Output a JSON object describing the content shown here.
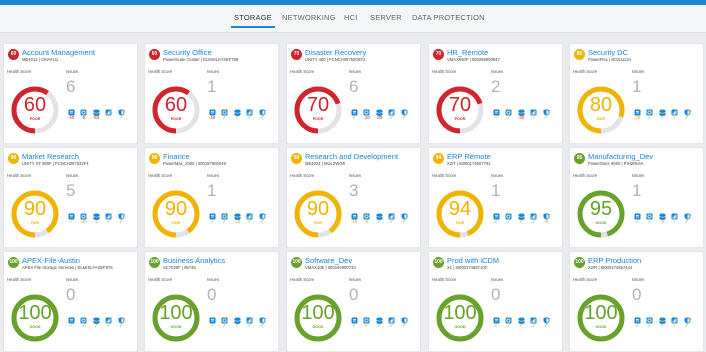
{
  "colors": {
    "accent": "#1a86d0",
    "poor": "#d0242e",
    "fair": "#f0b400",
    "good": "#67a22a"
  },
  "tabs": [
    "STORAGE",
    "NETWORKING",
    "HCI",
    "SERVER",
    "DATA PROTECTION"
  ],
  "labels": {
    "health": "Health Score",
    "issues": "Issues"
  },
  "category_icons": [
    "capacity-icon",
    "performance-icon",
    "system-health-icon",
    "configuration-icon",
    "data-protection-icon"
  ],
  "cards": [
    {
      "score": "60",
      "title": "Account Management",
      "sub": "ME4012 | CI0AFU1",
      "health": 60,
      "status": "POOR",
      "issues": "6",
      "stats": [
        "-40",
        "-5",
        "-53",
        "–",
        "–"
      ]
    },
    {
      "score": "60",
      "title": "Security Office",
      "sub": "PowerScale Cluster | ELMISLFASEF789",
      "health": 60,
      "status": "POOR",
      "issues": "1",
      "stats": [
        "-40",
        "✓",
        "✓",
        "✓",
        "✓"
      ]
    },
    {
      "score": "70",
      "title": "Disaster Recovery",
      "sub": "UNITY 400 | FCNCH097520SF2",
      "health": 70,
      "status": "POOR",
      "issues": "6",
      "stats": [
        "✓",
        "-10",
        "-30",
        "✓",
        "✓"
      ]
    },
    {
      "score": "70",
      "title": "HR_Remote",
      "sub": "VMAX950F | 000296800847",
      "health": 70,
      "status": "POOR",
      "issues": "2",
      "stats": [
        "–",
        "✓",
        "-30",
        "–",
        "–"
      ]
    },
    {
      "score": "80",
      "title": "Security DC",
      "sub": "PowerFlex | 8C0U1134",
      "health": 80,
      "status": "FAIR",
      "issues": "1",
      "stats": [
        "-20",
        "✓",
        "✓",
        "✓",
        "✓"
      ]
    },
    {
      "score": "90",
      "title": "Market Research",
      "sub": "UNITY XT 880F | FCNCH097532F4",
      "health": 90,
      "status": "FAIR",
      "issues": "5",
      "stats": [
        "✓",
        "-10",
        "-5",
        "✓",
        "✓"
      ]
    },
    {
      "score": "90",
      "title": "Finance",
      "sub": "PowerMax_2000 | 000197900049",
      "health": 90,
      "status": "FAIR",
      "issues": "1",
      "stats": [
        "✓",
        "✓",
        "-10",
        "✓",
        "✓"
      ]
    },
    {
      "score": "90",
      "title": "Research and Development",
      "sub": "ME4024 | MULZWG8",
      "health": 90,
      "status": "FAIR",
      "issues": "3",
      "stats": [
        "-10",
        "-5",
        "✓",
        "✓",
        "✓"
      ]
    },
    {
      "score": "94",
      "title": "ERP Remote",
      "sub": "X2/T | 8I000174657791",
      "health": 94,
      "status": "FAIR",
      "issues": "1",
      "stats": [
        "✓",
        "✓",
        "✓",
        "✓",
        "-6"
      ]
    },
    {
      "score": "95",
      "title": "Manufacturing_Dev",
      "sub": "PowerStore 9000 | PIH2RL6A",
      "health": 95,
      "status": "GOOD",
      "issues": "1",
      "stats": [
        "✓",
        "✓",
        "-5",
        "✓",
        "✓"
      ]
    },
    {
      "score": "100",
      "title": "APEX-File-Austin",
      "sub": "APEX File Storage Services | ELMISLFASEF876",
      "health": 100,
      "status": "GOOD",
      "issues": "0",
      "stats": [
        "✓",
        "✓",
        "✓",
        "✓",
        "✓"
      ]
    },
    {
      "score": "100",
      "title": "Business Analytics",
      "sub": "SC7020F | 95749",
      "health": 100,
      "status": "GOOD",
      "issues": "0",
      "stats": [
        "✓",
        "✓",
        "✓",
        "✓",
        "✓"
      ]
    },
    {
      "score": "100",
      "title": "Software_Dev",
      "sub": "VMAX10E | 000194900733",
      "health": 100,
      "status": "GOOD",
      "issues": "0",
      "stats": [
        "✓",
        "✓",
        "✓",
        "✓",
        "✓"
      ]
    },
    {
      "score": "100",
      "title": "Prod with iCDM",
      "sub": "X1 | 8I000174657100",
      "health": 100,
      "status": "GOOD",
      "issues": "0",
      "stats": [
        "✓",
        "✓",
        "✓",
        "✓",
        "✓"
      ]
    },
    {
      "score": "100",
      "title": "ERP Production",
      "sub": "X2/R | 8I000174657444",
      "health": 100,
      "status": "GOOD",
      "issues": "0",
      "stats": [
        "✓",
        "✓",
        "✓",
        "✓",
        "✓"
      ]
    }
  ]
}
